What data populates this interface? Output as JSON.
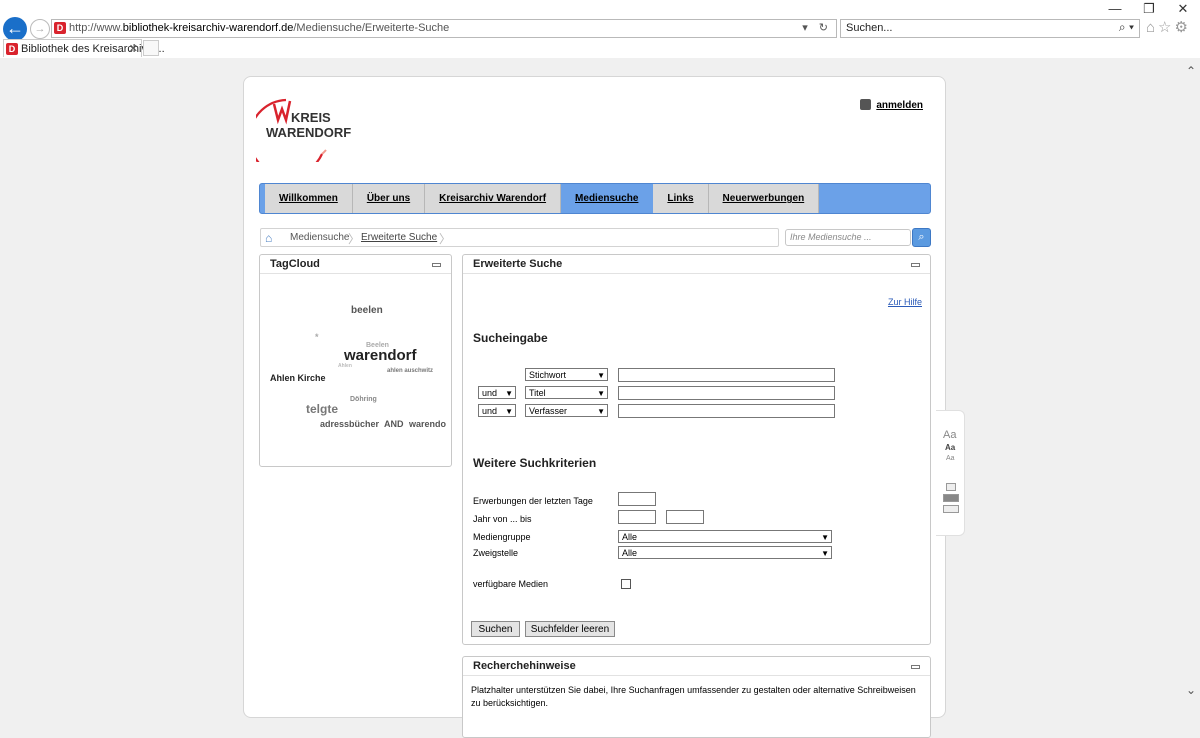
{
  "browser": {
    "window_controls": [
      "—",
      "❐",
      "✕"
    ],
    "url_prefix": "http://www.",
    "url_domain": "bibliothek-kreisarchiv-warendorf.de",
    "url_path": "/Mediensuche/Erweiterte-Suche",
    "url_icons": "▾ ↻",
    "search_placeholder": "Suchen...",
    "search_icons": "⌕ ▾",
    "toolbar_icons": "⌂☆⚙",
    "tab_title": "Bibliothek des Kreisarchivs ...",
    "tab_close": "✕",
    "favicon_letter": "D"
  },
  "header": {
    "logo_line1": "KREIS",
    "logo_line2": "WARENDORF",
    "login_label": "anmelden"
  },
  "nav": {
    "items": [
      {
        "label": "Willkommen"
      },
      {
        "label": "Über uns"
      },
      {
        "label": "Kreisarchiv Warendorf"
      },
      {
        "label": "Mediensuche"
      },
      {
        "label": "Links"
      },
      {
        "label": "Neuerwerbungen"
      }
    ],
    "active": "Mediensuche"
  },
  "breadcrumb": {
    "items": [
      "Mediensuche",
      "Erweiterte Suche"
    ]
  },
  "quicksearch": {
    "placeholder": "Ihre Mediensuche ..."
  },
  "tagcloud": {
    "title": "TagCloud",
    "tags": [
      {
        "text": "beelen",
        "color": "#555555"
      },
      {
        "text": "*",
        "color": "#aaaaaa"
      },
      {
        "text": "Beelen",
        "color": "#aaaaaa"
      },
      {
        "text": "warendorf",
        "color": "#222222"
      },
      {
        "text": "Ahlen",
        "color": "#bbbbbb"
      },
      {
        "text": "ahlen auschwitz",
        "color": "#777777"
      },
      {
        "text": "Ahlen Kirche",
        "color": "#222222"
      },
      {
        "text": "Döhring",
        "color": "#888888"
      },
      {
        "text": "telgte",
        "color": "#777777"
      },
      {
        "text": "adressbücher",
        "color": "#555555"
      },
      {
        "text": "AND",
        "color": "#555555"
      },
      {
        "text": "warendo",
        "color": "#555555"
      }
    ]
  },
  "search": {
    "title": "Erweiterte Suche",
    "help_label": "Zur Hilfe",
    "section1": "Sucheingabe",
    "rows": [
      {
        "op": "",
        "field": "Stichwort",
        "value": ""
      },
      {
        "op": "und",
        "field": "Titel",
        "value": ""
      },
      {
        "op": "und",
        "field": "Verfasser",
        "value": ""
      }
    ],
    "section2": "Weitere Suchkriterien",
    "criteria": {
      "days_label": "Erwerbungen der letzten Tage",
      "year_label": "Jahr von ... bis",
      "mediagroup_label": "Mediengruppe",
      "mediagroup_value": "Alle",
      "branch_label": "Zweigstelle",
      "branch_value": "Alle",
      "available_label": "verfügbare Medien"
    },
    "search_button": "Suchen",
    "clear_button": "Suchfelder leeren"
  },
  "recherche": {
    "title": "Recherchehinweise",
    "text": "Platzhalter unterstützen Sie dabei, Ihre Suchanfragen umfassender zu gestalten oder alternative Schreibweisen zu berücksichtigen."
  },
  "textsize": {
    "large": "Aa",
    "medium": "Aa",
    "small": "Aa"
  },
  "colors": {
    "nav_bar": "#6ba1e8",
    "logo_red": "#d9232d",
    "link_blue": "#2a5ab8"
  }
}
